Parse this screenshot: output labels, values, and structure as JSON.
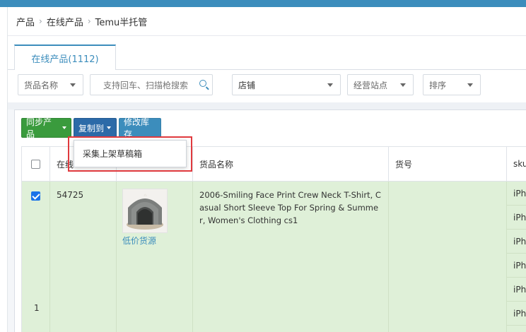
{
  "breadcrumb": {
    "items": [
      "产品",
      "在线产品",
      "Temu半托管"
    ]
  },
  "tabs": [
    {
      "label": "在线产品(1112)",
      "active": true
    }
  ],
  "filters": {
    "product_name_select": "货品名称",
    "search_placeholder": "支持回车、扫描枪搜索",
    "store_select": "店铺",
    "site_select": "经营站点",
    "sort_select": "排序"
  },
  "toolbar": {
    "sync_label": "同步产品",
    "copy_to_label": "复制到",
    "edit_stock_label": "修改库存"
  },
  "dropdown_menu": {
    "items": [
      "采集上架草稿箱"
    ]
  },
  "table": {
    "columns": [
      "在线",
      "",
      "货品名称",
      "货号",
      "sku"
    ],
    "header_col1_visible": "在线",
    "header_last_visible": "sku,",
    "rows": [
      {
        "selected": true,
        "online_id": "54725",
        "row_number": "1",
        "image_link": "低价货源",
        "product_name": "2006-Smiling Face Print Crew Neck T-Shirt, Casual Short Sleeve Top For Spring & Summer, Women's Clothing cs1",
        "item_no": "",
        "skus": [
          "iPho",
          "iPho",
          "iPho",
          "iPho",
          "iPho",
          "iPho"
        ]
      }
    ]
  },
  "colors": {
    "accent": "#3c8dbc",
    "sync_button": "#3a9b3d",
    "copy_button": "#2c6aa8",
    "selected_row": "#dff0d8",
    "highlight_box": "#e03a3e"
  }
}
